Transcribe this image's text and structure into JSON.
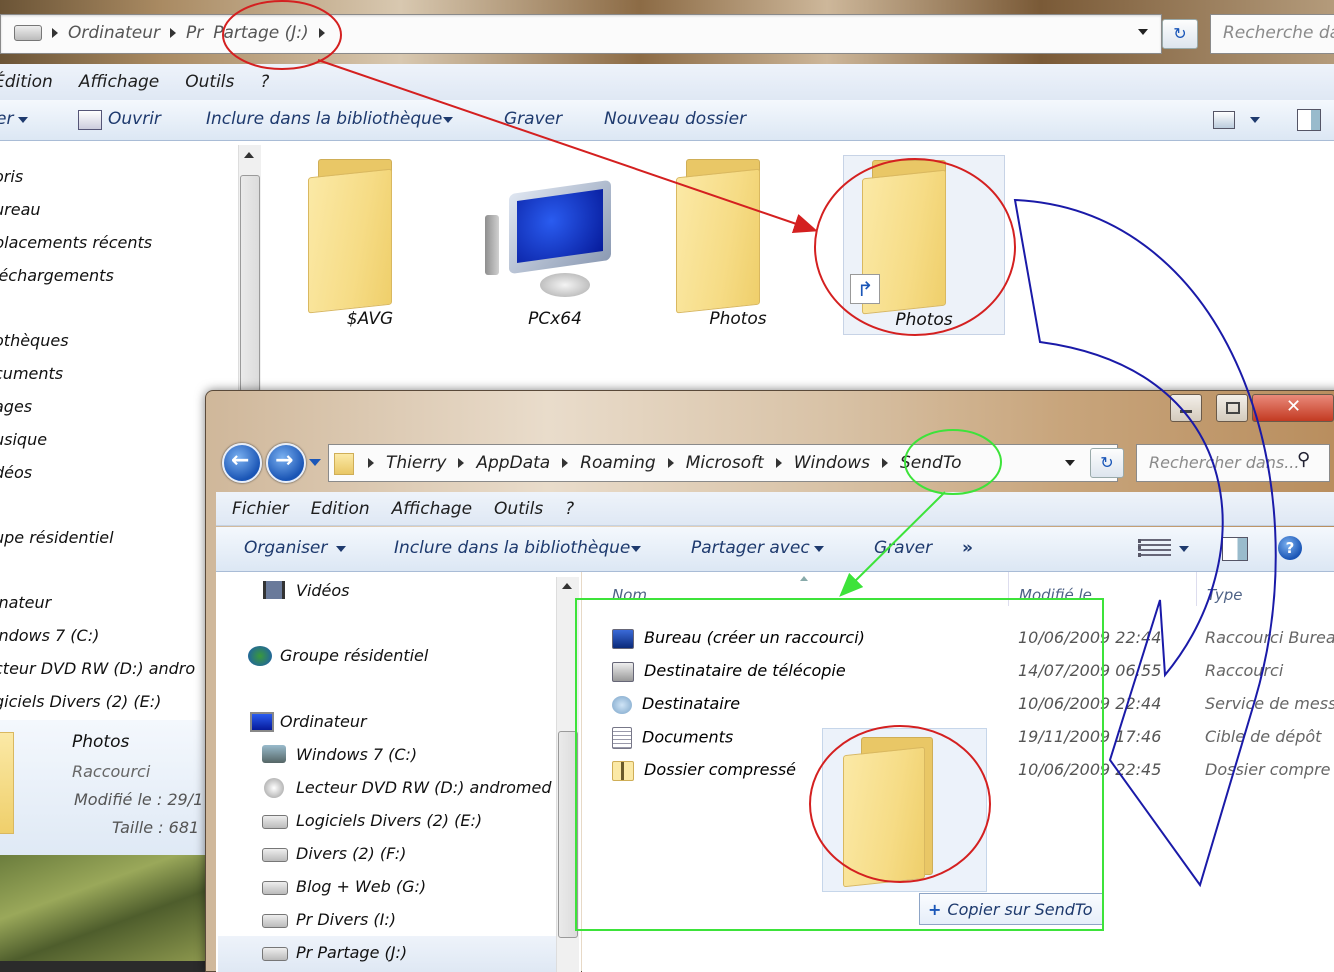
{
  "back": {
    "crumbs": [
      "Ordinateur",
      "Pr",
      "Partage (J:)"
    ],
    "search_placeholder": "Recherche dans",
    "menu": [
      "Édition",
      "Affichage",
      "Outils",
      "?"
    ],
    "toolbar": {
      "organize": "er",
      "open": "Ouvrir",
      "include": "Inclure dans la bibliothèque",
      "burn": "Graver",
      "new_folder": "Nouveau dossier"
    },
    "nav": [
      "oris",
      "ureau",
      "placements récents",
      "léchargements",
      "othèques",
      "cuments",
      "ages",
      "usique",
      "déos",
      "upe résidentiel",
      "inateur",
      "indows 7 (C:)",
      "cteur DVD RW (D:) andro",
      "giciels Divers (2) (E:)"
    ],
    "items": [
      "$AVG",
      "PCx64",
      "Photos",
      "Photos"
    ],
    "details": {
      "name": "Photos",
      "type": "Raccourci",
      "modified": "Modifié le : 29/1",
      "size": "Taille : 681"
    }
  },
  "front": {
    "crumbs": [
      "Thierry",
      "AppData",
      "Roaming",
      "Microsoft",
      "Windows",
      "SendTo"
    ],
    "search_placeholder": "Rechercher dans...",
    "menu": [
      "Fichier",
      "Edition",
      "Affichage",
      "Outils",
      "?"
    ],
    "toolbar": {
      "organize": "Organiser",
      "include": "Inclure dans la bibliothèque",
      "share": "Partager avec",
      "burn": "Graver",
      "more": "»"
    },
    "nav": {
      "videos": "Vidéos",
      "homegroup": "Groupe résidentiel",
      "computer": "Ordinateur",
      "drives": [
        "Windows 7 (C:)",
        "Lecteur DVD RW (D:) andromed",
        "Logiciels Divers (2) (E:)",
        "Divers (2) (F:)",
        "Blog + Web (G:)",
        "Pr  Divers (I:)",
        "Pr  Partage (J:)"
      ]
    },
    "columns": [
      "Nom",
      "Modifié le",
      "Type"
    ],
    "rows": [
      {
        "name": "Bureau (créer un raccourci)",
        "date": "10/06/2009 22:44",
        "type": "Raccourci Bureau"
      },
      {
        "name": "Destinataire de télécopie",
        "date": "14/07/2009 06:55",
        "type": "Raccourci"
      },
      {
        "name": "Destinataire",
        "date": "10/06/2009 22:44",
        "type": "Service de mess"
      },
      {
        "name": "Documents",
        "date": "19/11/2009 17:46",
        "type": "Cible de dépôt"
      },
      {
        "name": "Dossier compressé",
        "date": "10/06/2009 22:45",
        "type": "Dossier compre"
      }
    ],
    "tooltip": "Copier sur SendTo",
    "tooltip_icon": "+"
  },
  "colors": {
    "red_annotation": "#d42020",
    "blue_arrow": "#1a1aa8",
    "green_annotation": "#3de33a",
    "toolbar_text": "#1e3a6e"
  }
}
